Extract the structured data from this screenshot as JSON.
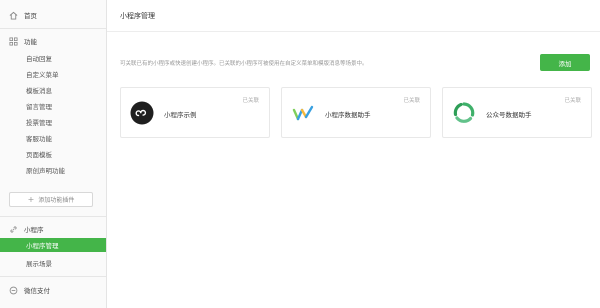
{
  "sidebar": {
    "home": {
      "label": "首页",
      "icon": "home-icon"
    },
    "features": {
      "label": "功能",
      "icon": "grid-icon",
      "items": [
        {
          "label": "自动回复"
        },
        {
          "label": "自定义菜单"
        },
        {
          "label": "模板消息"
        },
        {
          "label": "留言管理"
        },
        {
          "label": "投票管理"
        },
        {
          "label": "客服功能"
        },
        {
          "label": "页面模板"
        },
        {
          "label": "原创声明功能"
        }
      ],
      "add_plugin": "添加功能插件"
    },
    "miniprogram": {
      "label": "小程序",
      "icon": "link-icon",
      "items": [
        {
          "label": "小程序管理",
          "active": true
        },
        {
          "label": "展示场景"
        }
      ]
    },
    "wechat_pay": {
      "label": "微信支付",
      "icon": "wallet-icon"
    }
  },
  "main": {
    "title": "小程序管理",
    "description": "可关联已有的小程序或快速创建小程序。已关联的小程序可被使用在自定义菜单和模版消息等场景中。",
    "add_button": "添加",
    "cards": [
      {
        "name": "小程序示例",
        "badge": "已关联",
        "icon": "miniprogram-logo-icon"
      },
      {
        "name": "小程序数据助手",
        "badge": "已关联",
        "icon": "data-assistant-logo-icon"
      },
      {
        "name": "公众号数据助手",
        "badge": "已关联",
        "icon": "official-account-data-logo-icon"
      }
    ]
  },
  "colors": {
    "accent": "#44b549",
    "sidebar_bg": "#fafafa",
    "main_bg": "#ffffff"
  }
}
